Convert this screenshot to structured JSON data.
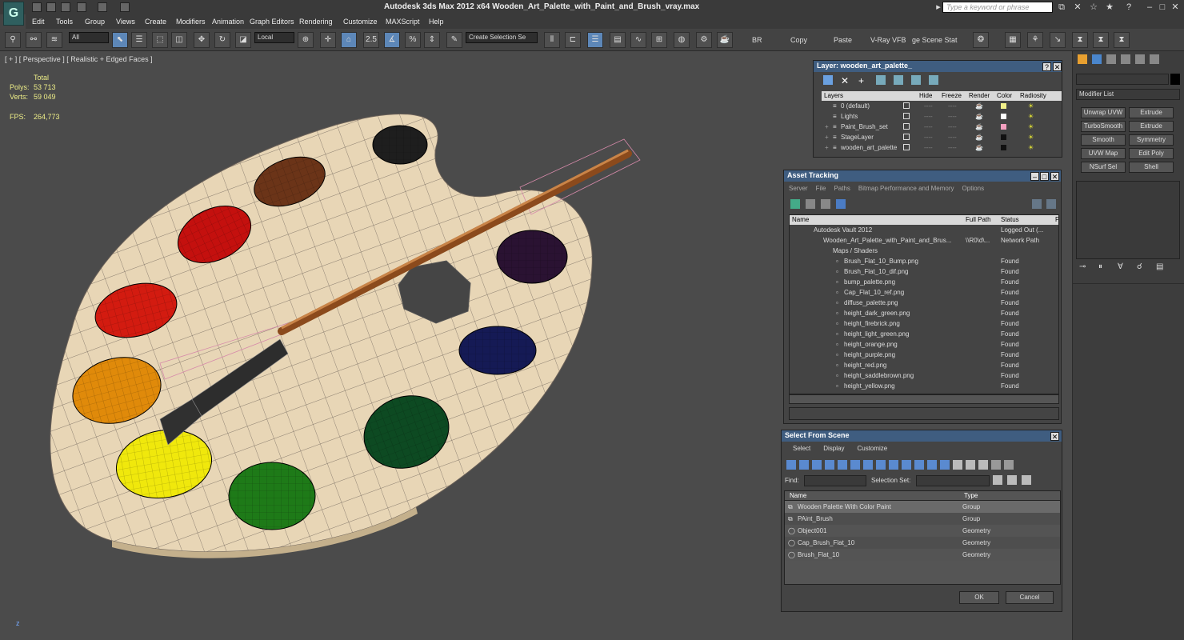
{
  "app": {
    "title": "Autodesk 3ds Max  2012 x64    Wooden_Art_Palette_with_Paint_and_Brush_vray.max",
    "search_placeholder": "Type a keyword or phrase",
    "help_icon": "?"
  },
  "menu": [
    "Edit",
    "Tools",
    "Group",
    "Views",
    "Create",
    "Modifiers",
    "Animation",
    "Graph Editors",
    "Rendering",
    "Customize",
    "MAXScript",
    "Help"
  ],
  "toolbar": {
    "filter": "All",
    "refcoord": "Local",
    "snap_angle": "2.5",
    "selection_set": "Create Selection Se",
    "br": "BR",
    "copy": "Copy",
    "paste": "Paste",
    "vray_vfb": "V-Ray VFB",
    "stage_scene": "ge Scene Stat"
  },
  "viewport": {
    "label": "[ + ] [ Perspective ] [ Realistic + Edged Faces ]",
    "stats_header": "Total",
    "polys_label": "Polys:",
    "polys_value": "53 713",
    "verts_label": "Verts:",
    "verts_value": "59 049",
    "fps_label": "FPS:",
    "fps_value": "264,773",
    "axis_z": "z"
  },
  "paint_colors": {
    "black": "#1e1e1e",
    "brown": "#6b3418",
    "red1": "#c4100e",
    "purple": "#2a1232",
    "red2": "#d31b10",
    "navy": "#151a55",
    "orange": "#e08a0a",
    "darkgreen": "#0d4a22",
    "yellow": "#f0e80c",
    "green": "#1e7a18",
    "wood": "#e8d6b6"
  },
  "layer_panel": {
    "title": "Layer: wooden_art_palette_",
    "columns": [
      "Layers",
      "Hide",
      "Freeze",
      "Render",
      "Color",
      "Radiosity"
    ],
    "rows": [
      {
        "name": "0 (default)",
        "color": "#f2f08a"
      },
      {
        "name": "Lights",
        "color": "#ffffff"
      },
      {
        "name": "Paint_Brush_set",
        "color": "#f4a0c0"
      },
      {
        "name": "StageLayer",
        "color": "#111111"
      },
      {
        "name": "wooden_art_palette",
        "color": "#111111"
      }
    ],
    "freeze_dash": "----"
  },
  "asset_tracking": {
    "title": "Asset Tracking",
    "menu": [
      "Server",
      "File",
      "Paths",
      "Bitmap Performance and Memory",
      "Options"
    ],
    "columns": [
      "Name",
      "Full Path",
      "Status",
      "P"
    ],
    "vault": {
      "name": "Autodesk Vault 2012",
      "status": "Logged Out (..."
    },
    "scene": {
      "name": "Wooden_Art_Palette_with_Paint_and_Brus...",
      "path": "\\\\R0\\d\\...",
      "status": "Network Path"
    },
    "group": "Maps / Shaders",
    "files": [
      {
        "name": "Brush_Flat_10_Bump.png",
        "status": "Found"
      },
      {
        "name": "Brush_Flat_10_dif.png",
        "status": "Found"
      },
      {
        "name": "bump_palette.png",
        "status": "Found"
      },
      {
        "name": "Cap_Flat_10_ref.png",
        "status": "Found"
      },
      {
        "name": "diffuse_palette.png",
        "status": "Found"
      },
      {
        "name": "height_dark_green.png",
        "status": "Found"
      },
      {
        "name": "height_firebrick.png",
        "status": "Found"
      },
      {
        "name": "height_light_green.png",
        "status": "Found"
      },
      {
        "name": "height_orange.png",
        "status": "Found"
      },
      {
        "name": "height_purple.png",
        "status": "Found"
      },
      {
        "name": "height_red.png",
        "status": "Found"
      },
      {
        "name": "height_saddlebrown.png",
        "status": "Found"
      },
      {
        "name": "height_yellow.png",
        "status": "Found"
      }
    ]
  },
  "select_from_scene": {
    "title": "Select From Scene",
    "menu": [
      "Select",
      "Display",
      "Customize"
    ],
    "find_label": "Find:",
    "selection_set_label": "Selection Set:",
    "columns": [
      "Name",
      "Type"
    ],
    "rows": [
      {
        "name": "Wooden Palette With Color Paint",
        "type": "Group"
      },
      {
        "name": "PAint_Brush",
        "type": "Group"
      },
      {
        "name": "Object001",
        "type": "Geometry"
      },
      {
        "name": "Cap_Brush_Flat_10",
        "type": "Geometry"
      },
      {
        "name": "Brush_Flat_10",
        "type": "Geometry"
      }
    ],
    "ok": "OK",
    "cancel": "Cancel"
  },
  "command_panel": {
    "modifier_list": "Modifier List",
    "buttons": [
      "Unwrap UVW",
      "Extrude",
      "TurboSmooth",
      "Extrude",
      "Smooth",
      "Symmetry",
      "UVW Map",
      "Edit Poly",
      "NSurf Sel",
      "Shell"
    ]
  }
}
